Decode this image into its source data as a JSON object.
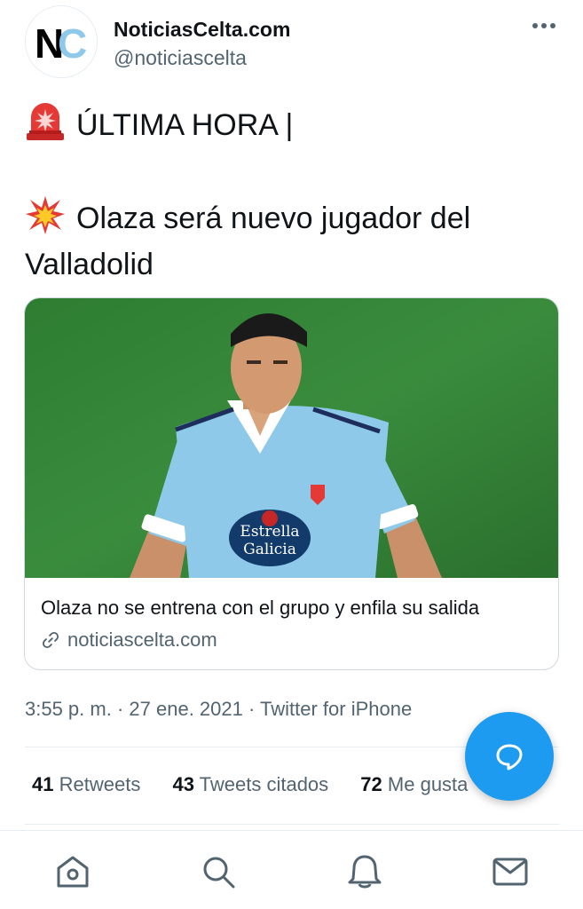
{
  "account": {
    "display_name": "NoticiasCelta.com",
    "handle": "@noticiascelta",
    "avatar_letters": "NC",
    "avatar_colors": {
      "letter_n": "#000000",
      "letter_c": "#8ec9ea"
    }
  },
  "tweet": {
    "line1_emoji": "rotating-light-icon",
    "line1_text": "ÚLTIMA HORA |",
    "line2_emoji": "collision-icon",
    "line2_text": "Olaza será nuevo jugador del",
    "line3_text": "Valladolid"
  },
  "card": {
    "image": "player-photo",
    "title": "Olaza no se entrena con el grupo y enfila su salida",
    "url": "noticiascelta.com"
  },
  "meta": {
    "time": "3:55 p. m.",
    "sep1": " · ",
    "date": "27 ene. 2021",
    "sep2": " · ",
    "source": "Twitter for iPhone"
  },
  "stats": [
    {
      "count": "41",
      "label": "Retweets"
    },
    {
      "count": "43",
      "label": "Tweets citados"
    },
    {
      "count": "72",
      "label": "Me gusta"
    }
  ],
  "nav": [
    "home-icon",
    "search-icon",
    "notifications-icon",
    "messages-icon"
  ],
  "colors": {
    "accent": "#1d9bf0",
    "secondary_text": "#536471",
    "shirt": "#8ec9ea",
    "pitch": "#2f7d32"
  }
}
